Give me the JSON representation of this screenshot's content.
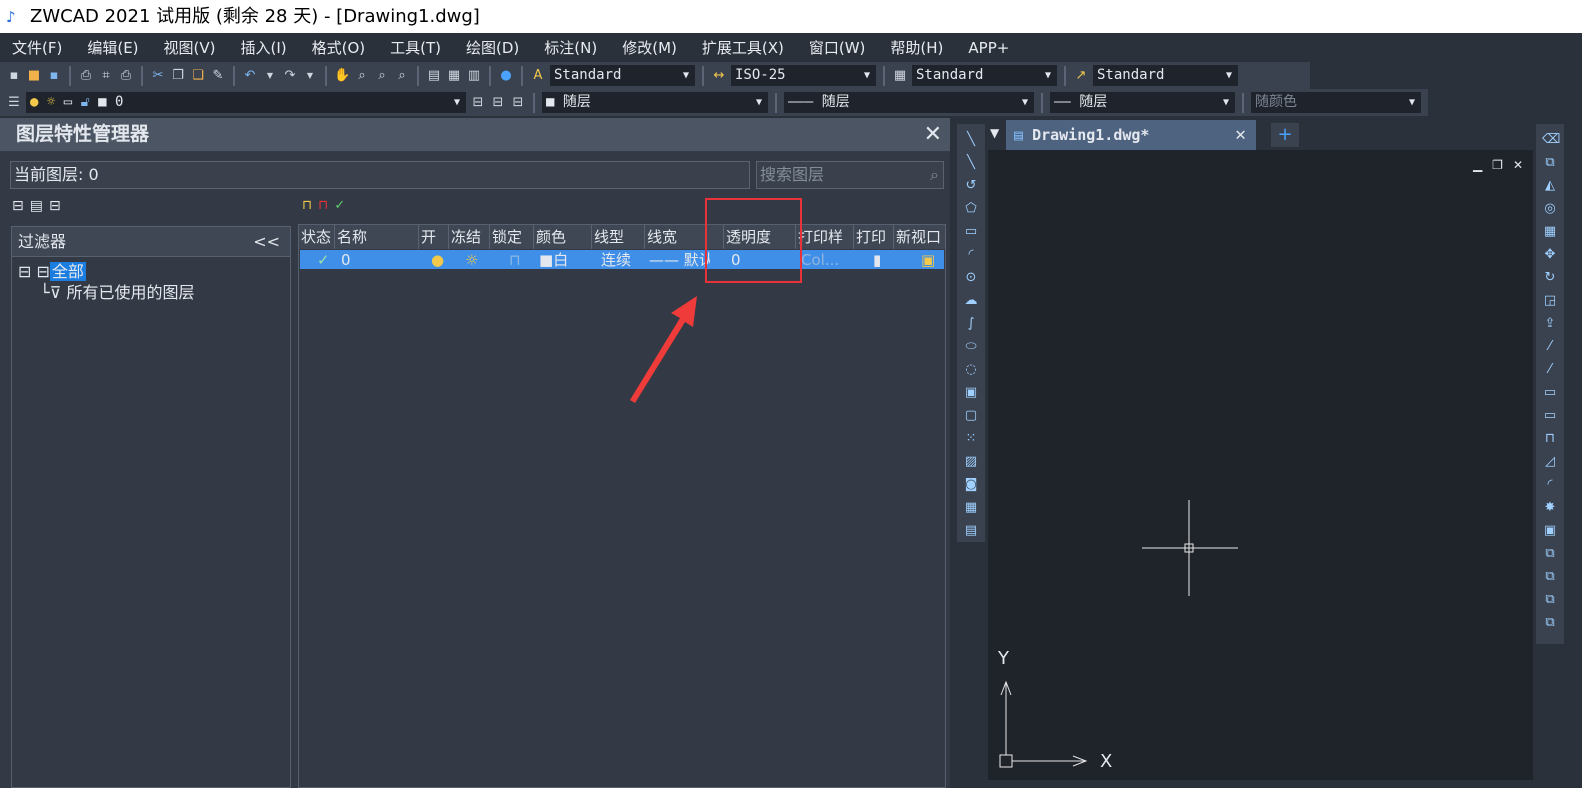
{
  "title": "ZWCAD 2021 试用版 (剩余 28 天) - [Drawing1.dwg]",
  "menu": [
    "文件(F)",
    "编辑(E)",
    "视图(V)",
    "插入(I)",
    "格式(O)",
    "工具(T)",
    "绘图(D)",
    "标注(N)",
    "修改(M)",
    "扩展工具(X)",
    "窗口(W)",
    "帮助(H)",
    "APP+"
  ],
  "toolbar": {
    "text_style": "Standard",
    "dim_style": "ISO-25",
    "table_style": "Standard",
    "mleader_style": "Standard",
    "layer": "0",
    "color": "随层",
    "linetype": "随层",
    "lineweight": "随层",
    "plotstyle": "随颜色"
  },
  "panel": {
    "title": "图层特性管理器",
    "current_layer": "当前图层: 0",
    "search_placeholder": "搜索图层",
    "filter_header": "过滤器",
    "collapse": "<<",
    "tree": [
      "全部",
      "所有已使用的图层"
    ]
  },
  "table": {
    "headers": [
      "状态",
      "名称",
      "开",
      "冻结",
      "锁定",
      "颜色",
      "线型",
      "线宽",
      "透明度",
      "打印样",
      "打印",
      "新视口"
    ],
    "rows": [
      {
        "status": "✓",
        "name": "0",
        "color": "白",
        "linetype": "连续",
        "lineweight": "—— 默认",
        "transparency": "0",
        "plotstyle": "Col..."
      }
    ]
  },
  "tabs": {
    "active": "Drawing1.dwg*"
  },
  "axes": {
    "x": "X",
    "y": "Y"
  },
  "colors": {
    "highlight": "#3f8fe8",
    "annotation": "#e8323a"
  }
}
